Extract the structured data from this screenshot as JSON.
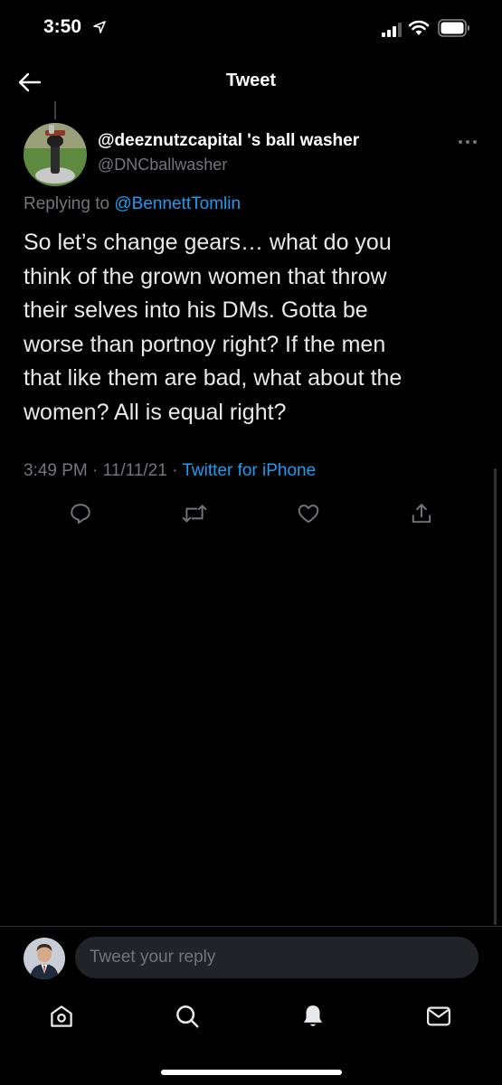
{
  "status_bar": {
    "time": "3:50"
  },
  "header": {
    "title": "Tweet"
  },
  "tweet": {
    "display_name": "@deeznutzcapital 's ball washer",
    "handle": "@DNCballwasher",
    "replying_prefix": "Replying to",
    "replying_to": "@BennettTomlin",
    "text": "So let’s change gears… what do you\nthink of the grown women that throw\ntheir selves into his DMs. Gotta be\nworse than portnoy right? If the men\nthat like them are bad, what about the\nwomen? All is equal right?",
    "time": "3:49 PM",
    "date": "11/11/21",
    "separator": "·",
    "source": "Twitter for iPhone"
  },
  "actions": {
    "icons": [
      "reply-icon",
      "retweet-icon",
      "like-icon",
      "share-icon"
    ]
  },
  "composer": {
    "placeholder": "Tweet your reply"
  },
  "tab_bar": {
    "icons": [
      "home-icon",
      "search-icon",
      "notifications-icon",
      "messages-icon"
    ]
  },
  "colors": {
    "background": "#000000",
    "accent": "#1d9bf0",
    "secondary_text": "#71767b",
    "primary_text": "#e7e9ea"
  }
}
